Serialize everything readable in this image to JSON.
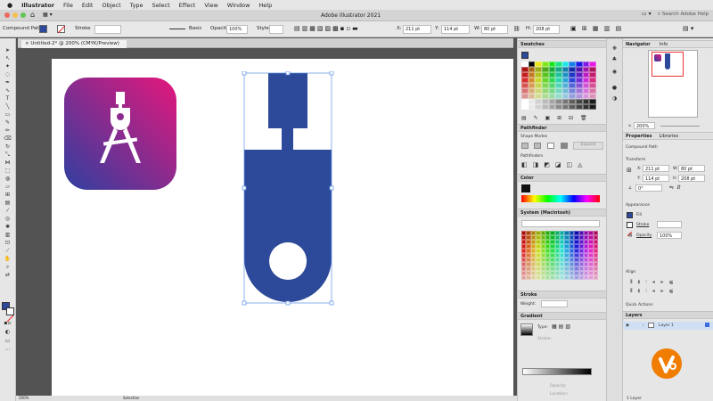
{
  "menubar": {
    "app": "Illustrator",
    "items": [
      "File",
      "Edit",
      "Object",
      "Type",
      "Select",
      "Effect",
      "View",
      "Window",
      "Help"
    ]
  },
  "titlebar": {
    "title": "Adobe Illustrator 2021",
    "search_placeholder": "Search Adobe Help"
  },
  "options": {
    "selection": "Compound Path",
    "stroke_label": "Stroke",
    "brush": "Basic",
    "opacity_label": "Opacity",
    "opacity": "100%",
    "style_label": "Style",
    "x": "211 pt",
    "y": "114 pt",
    "w": "80 pt",
    "h": "208 pt"
  },
  "document": {
    "tab": "Untitled-2* @ 200% (CMYK/Preview)"
  },
  "swatches": {
    "title": "Swatches"
  },
  "pathfinder": {
    "title": "Pathfinder",
    "shape_modes": "Shape Modes",
    "pathfinders": "Pathfinders",
    "expand": "Expand"
  },
  "color": {
    "title": "Color"
  },
  "system": {
    "title": "System (Macintosh)"
  },
  "stroke_panel": {
    "title": "Stroke",
    "weight": "Weight:"
  },
  "gradient": {
    "title": "Gradient",
    "type": "Type:",
    "stroke": "Stroke:",
    "opacity": "Opacity:",
    "location": "Location:"
  },
  "navigator": {
    "title": "Navigator",
    "info": "Info",
    "zoom": "200%"
  },
  "properties": {
    "tab1": "Properties",
    "tab2": "Libraries",
    "object": "Compound Path",
    "transform": "Transform",
    "x": "211 pt",
    "y": "114 pt",
    "w": "80 pt",
    "h": "208 pt",
    "angle": "0°",
    "appearance": "Appearance",
    "fill": "Fill",
    "stroke": "Stroke",
    "opacity": "Opacity",
    "opacity_val": "100%",
    "align": "Align",
    "quick": "Quick Actions"
  },
  "layers": {
    "title": "Layers",
    "layer1": "Layer 1",
    "count": "1 Layer"
  },
  "status": {
    "zoom": "200%",
    "tool": "Selection"
  },
  "colors": {
    "blue": "#2d4a9a",
    "accent": "#f07c00"
  }
}
